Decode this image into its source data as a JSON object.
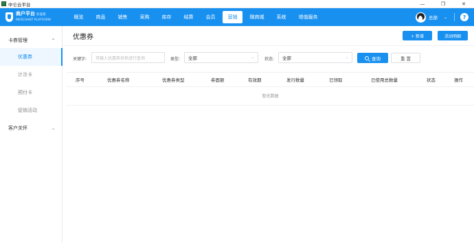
{
  "window": {
    "title": "中仑云平台",
    "controls": [
      "—",
      "❐",
      "✕"
    ]
  },
  "logo": {
    "name": "商户平台",
    "version": "标准版",
    "subtitle": "MERCHANT PLATFORM"
  },
  "topnav": {
    "items": [
      "概览",
      "商品",
      "销售",
      "采购",
      "库存",
      "结算",
      "会员",
      "营销",
      "微商城",
      "系统",
      "增值服务"
    ],
    "active": "营销",
    "user": "总部",
    "help": "?"
  },
  "sidebar": {
    "groups": [
      {
        "label": "卡券管理",
        "expanded": true,
        "items": [
          "优惠券",
          "计次卡",
          "预付卡",
          "促销活动"
        ]
      },
      {
        "label": "客户关怀",
        "expanded": false,
        "items": []
      }
    ],
    "active_item": "优惠券"
  },
  "page": {
    "title": "优惠券",
    "add_button": "+ 新增",
    "guide_button": "活动明细"
  },
  "filters": {
    "keyword_label": "关键字:",
    "keyword_placeholder": "可输入优惠券名称进行查询",
    "type_label": "类型:",
    "type_value": "全部",
    "status_label": "状态:",
    "status_value": "全部",
    "search_button": "查询",
    "reset_button": "重 置"
  },
  "table": {
    "columns": [
      "序号",
      "优惠券名称",
      "优惠券类型",
      "券面额",
      "有效期",
      "发行数量",
      "已领取",
      "已使用总数量",
      "状态",
      "操作"
    ],
    "rows": [],
    "empty_text": "暂无数据"
  },
  "colors": {
    "primary": "#1890f0",
    "active_bg": "#eef6ff"
  }
}
